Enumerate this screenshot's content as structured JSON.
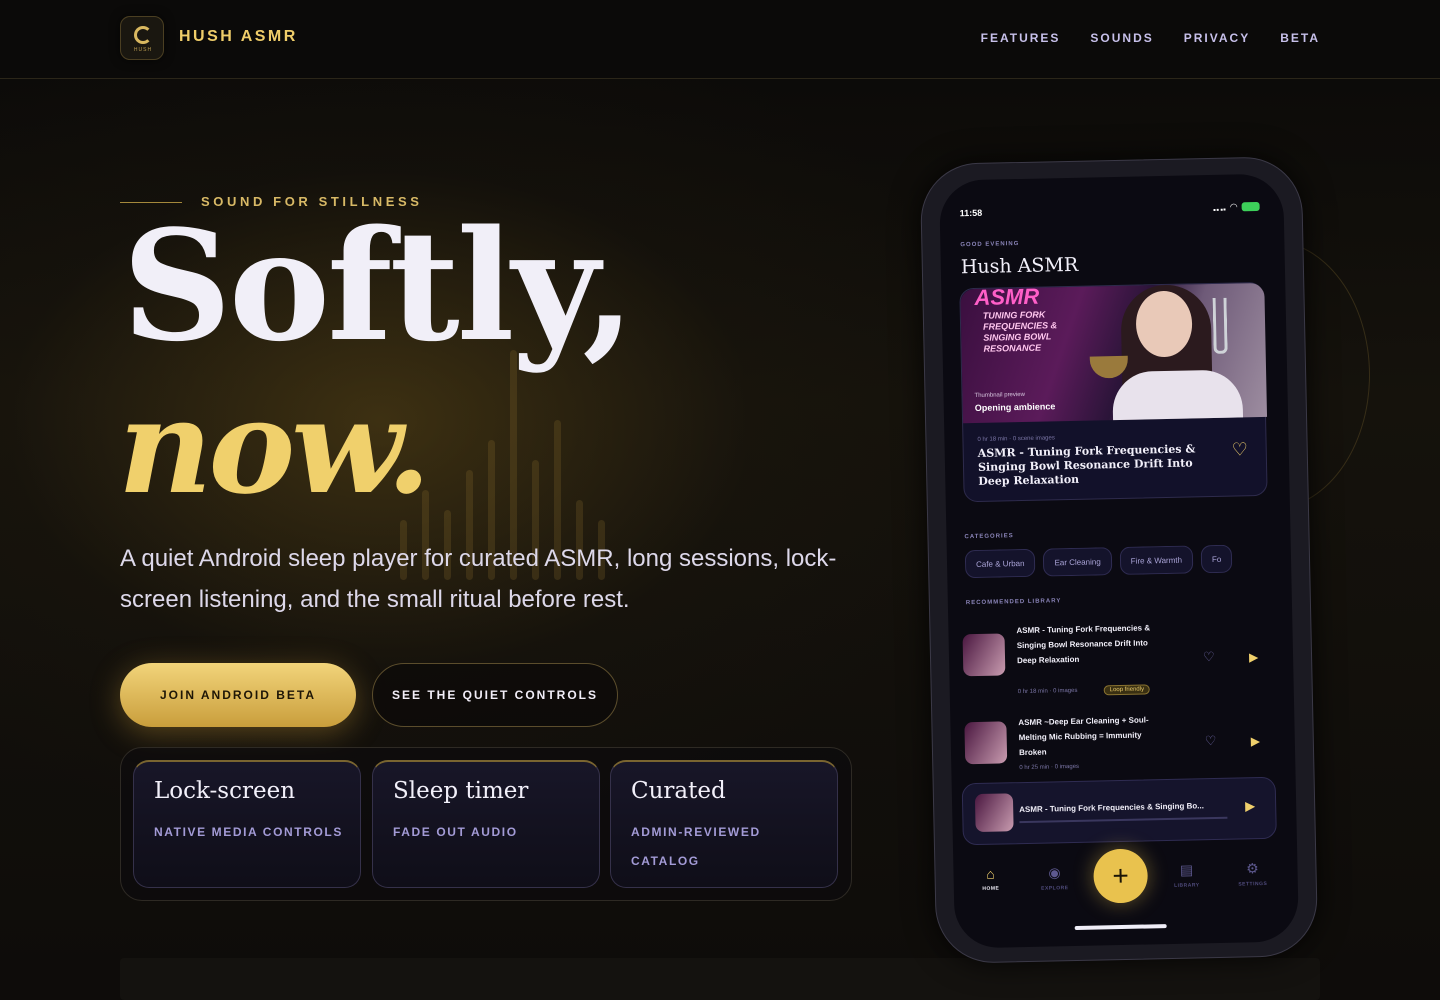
{
  "brand": {
    "name": "HUSH ASMR",
    "logo_text": "HUSH"
  },
  "nav": {
    "links": [
      "FEATURES",
      "SOUNDS",
      "PRIVACY",
      "BETA"
    ]
  },
  "hero": {
    "eyebrow": "SOUND FOR STILLNESS",
    "title_line1": "Softly,",
    "title_line2": "now.",
    "lead": "A quiet Android sleep player for curated ASMR, long sessions, lock-screen listening, and the small ritual before rest.",
    "primary_cta": "JOIN ANDROID BETA",
    "secondary_cta": "SEE THE QUIET CONTROLS"
  },
  "feature_cards": [
    {
      "title": "Lock-screen",
      "subtitle": "NATIVE MEDIA CONTROLS"
    },
    {
      "title": "Sleep timer",
      "subtitle": "FADE OUT AUDIO"
    },
    {
      "title": "Curated",
      "subtitle": "ADMIN-REVIEWED CATALOG"
    }
  ],
  "phone": {
    "status_time": "11:58",
    "greeting": "GOOD EVENING",
    "app_title": "Hush ASMR",
    "featured": {
      "thumb_heading": "ASMR",
      "thumb_text": "TUNING FORK FREQUENCIES & SINGING BOWL RESONANCE",
      "thumb_preview": "Thumbnail preview",
      "thumb_caption": "Opening ambience",
      "meta": "0 hr 18 min · 0 scene images",
      "title": "ASMR - Tuning Fork Frequencies & Singing Bowl Resonance  Drift Into Deep Relaxation"
    },
    "categories_label": "CATEGORIES",
    "categories": [
      "Cafe & Urban",
      "Ear Cleaning",
      "Fire & Warmth",
      "Fo"
    ],
    "library_label": "RECOMMENDED LIBRARY",
    "library": [
      {
        "title": "ASMR - Tuning Fork Frequencies & Singing Bowl Resonance  Drift Into Deep Relaxation",
        "meta": "0 hr 18 min · 0 images",
        "badge": "Loop friendly"
      },
      {
        "title": "ASMR ~Deep Ear Cleaning + Soul-Melting Mic Rubbing = Immunity Broken",
        "meta": "0 hr 25 min · 0 images",
        "badge": ""
      }
    ],
    "now_playing": "ASMR - Tuning Fork Frequencies & Singing Bo...",
    "tabs": [
      {
        "label": "HOME",
        "icon": "home-icon",
        "glyph": "⌂"
      },
      {
        "label": "EXPLORE",
        "icon": "compass-icon",
        "glyph": "◉"
      },
      {
        "label": "LIBRARY",
        "icon": "library-icon",
        "glyph": "▤"
      },
      {
        "label": "SETTINGS",
        "icon": "gear-icon",
        "glyph": "⚙"
      }
    ],
    "fab_glyph": "+"
  },
  "colors": {
    "accent": "#f0d06c",
    "lavender": "#a39bd6",
    "background": "#0c0b0a"
  }
}
